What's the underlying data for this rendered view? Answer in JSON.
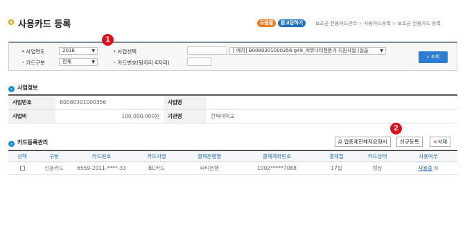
{
  "header": {
    "title": "사용카드 등록",
    "help_label": "도움말",
    "ask_label": "묻고답하기",
    "breadcrumb": [
      "보조금 전용카드관리",
      "사용카드등록",
      "보조금 전용카드 등록"
    ]
  },
  "annotations": {
    "marker1": "1",
    "marker2": "2"
  },
  "search": {
    "year_label": "사업연도",
    "year_value": "2018",
    "business_label": "사업선택",
    "business_value": "[  예치] B0080301000356 g49_커뮤니티전문가 지원사업 (실습",
    "card_type_label": "카드구분",
    "card_type_value": "전체",
    "card_last4_label": "카드번호(뒷자리 4자리)",
    "search_button": "조회"
  },
  "business_info": {
    "section_title": "사업정보",
    "rows": [
      [
        {
          "label": "사업번호",
          "value": "B0080301000356"
        },
        {
          "label": "사업명",
          "value": ""
        }
      ],
      [
        {
          "label": "사업비",
          "value": "100,000,000원"
        },
        {
          "label": "기관명",
          "value": "전북대학교"
        }
      ]
    ]
  },
  "card_mgmt": {
    "section_title": "카드등록관리",
    "btn_print": "업종제한해지요청서",
    "btn_new": "신규등록",
    "btn_delete": "삭제",
    "columns": [
      "선택",
      "구분",
      "카드번호",
      "카드사명",
      "결제은행명",
      "결제계좌번호",
      "결제일",
      "카드상태",
      "사용여부"
    ],
    "rows": [
      {
        "type": "신용카드",
        "card_no": "6559-2011-****-33",
        "company": "BC카드",
        "bank": "씨티은행",
        "account": "1002*****7088",
        "pay_day": "17일",
        "status": "정상",
        "use": "사용중"
      }
    ]
  }
}
